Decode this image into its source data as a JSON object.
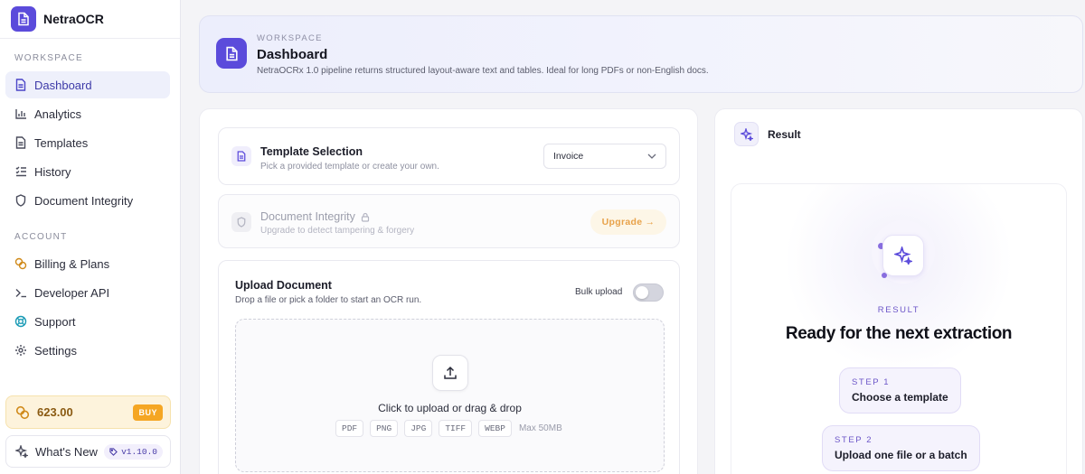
{
  "app": {
    "name": "NetraOCR"
  },
  "sidebar": {
    "section_workspace": "WORKSPACE",
    "section_account": "ACCOUNT",
    "workspace_items": [
      {
        "label": "Dashboard",
        "icon": "document-icon",
        "active": true
      },
      {
        "label": "Analytics",
        "icon": "bar-chart-icon"
      },
      {
        "label": "Templates",
        "icon": "document-icon"
      },
      {
        "label": "History",
        "icon": "list-icon"
      },
      {
        "label": "Document Integrity",
        "icon": "shield-icon"
      }
    ],
    "account_items": [
      {
        "label": "Billing & Plans",
        "icon": "coins-icon"
      },
      {
        "label": "Developer API",
        "icon": "terminal-icon"
      },
      {
        "label": "Support",
        "icon": "lifebuoy-icon"
      },
      {
        "label": "Settings",
        "icon": "gear-icon"
      }
    ],
    "credits": {
      "value": "623.00",
      "buy_label": "BUY"
    },
    "whats_new": {
      "label": "What's New",
      "version": "v1.10.0"
    }
  },
  "hero": {
    "eyebrow": "WORKSPACE",
    "title": "Dashboard",
    "subtitle": "NetraOCRx 1.0 pipeline returns structured layout-aware text and tables. Ideal for long PDFs or non-English docs."
  },
  "template_card": {
    "title": "Template Selection",
    "subtitle": "Pick a provided template or create your own.",
    "selected": "Invoice"
  },
  "integrity_card": {
    "title": "Document Integrity",
    "subtitle": "Upgrade to detect tampering & forgery",
    "upgrade_label": "Upgrade →"
  },
  "upload_card": {
    "title": "Upload Document",
    "subtitle": "Drop a file or pick a folder to start an OCR run.",
    "bulk_label": "Bulk upload",
    "bulk_enabled": false,
    "dropzone_text": "Click to upload or drag & drop",
    "formats": [
      "PDF",
      "PNG",
      "JPG",
      "TIFF",
      "WEBP"
    ],
    "max_size": "Max 50MB"
  },
  "result": {
    "header": "Result",
    "eyebrow": "RESULT",
    "title": "Ready for the next extraction",
    "steps": [
      {
        "label": "STEP 1",
        "text": "Choose a template"
      },
      {
        "label": "STEP 2",
        "text": "Upload one file or a batch"
      }
    ]
  },
  "colors": {
    "accent": "#5b4bdb",
    "credit": "#f5a623",
    "upgrade": "#e8a24a"
  }
}
